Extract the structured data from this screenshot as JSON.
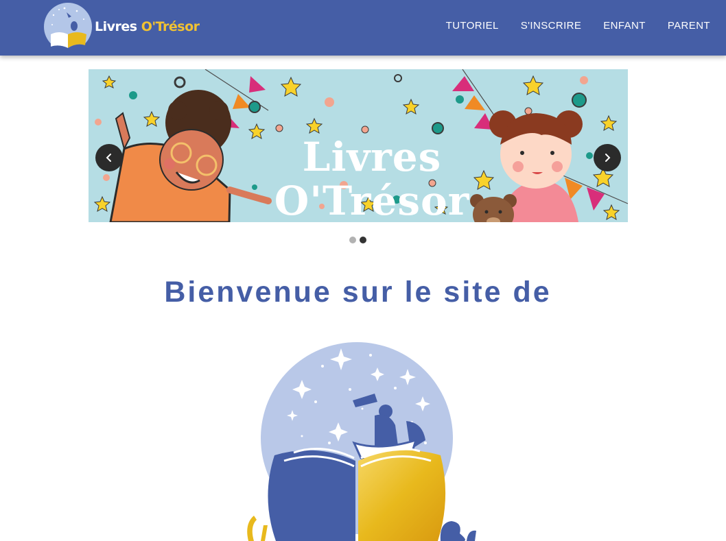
{
  "header": {
    "brand": {
      "word1": "Livres",
      "word2": "O'Trésor"
    },
    "nav": [
      "TUTORIEL",
      "S'INSCRIRE",
      "ENFANT",
      "PARENT"
    ]
  },
  "carousel": {
    "banner_text": "Livres O'Trésor",
    "prev_icon": "chevron-left-icon",
    "next_icon": "chevron-right-icon",
    "slide_count": 2,
    "active_slide": 2
  },
  "main": {
    "welcome": "Bienvenue sur le site de"
  },
  "colors": {
    "brand_blue": "#455ea6",
    "gold": "#f1c232",
    "banner_bg": "#b5dde4"
  }
}
